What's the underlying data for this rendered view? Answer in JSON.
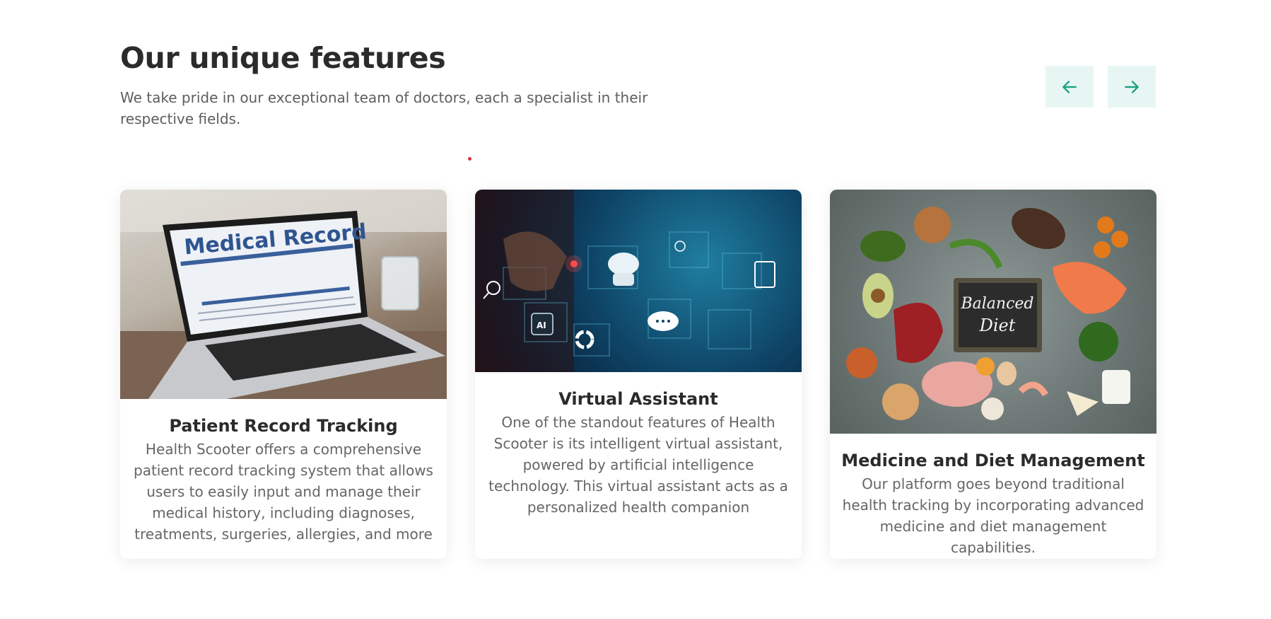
{
  "header": {
    "title": "Our unique features",
    "subtitle": "We take pride in our exceptional team of doctors, each a specialist in their respective fields."
  },
  "nav": {
    "prev_icon": "arrow-left-icon",
    "next_icon": "arrow-right-icon",
    "accent": "#1ea384",
    "button_bg": "#e8f6f3"
  },
  "cards": [
    {
      "title": "Patient Record Tracking",
      "text": "Health Scooter offers a comprehensive patient record tracking system that allows users to easily input and manage their medical history, including diagnoses, treatments, surgeries, allergies, and more",
      "image": {
        "heading": "Medical Record",
        "subject": "laptop-medical-record-image"
      }
    },
    {
      "title": "Virtual Assistant",
      "text": "One of the standout features of Health Scooter is its intelligent virtual assistant, powered by artificial intelligence technology. This virtual assistant acts as a personalized health companion",
      "image": {
        "badge": "AI",
        "subject": "virtual-assistant-hologram-image"
      }
    },
    {
      "title": "Medicine and Diet Management",
      "text": "Our platform goes beyond traditional health tracking by incorporating advanced medicine and diet management capabilities.",
      "image": {
        "chalkboard_line1": "Balanced",
        "chalkboard_line2": "Diet",
        "subject": "balanced-diet-food-image"
      }
    }
  ]
}
